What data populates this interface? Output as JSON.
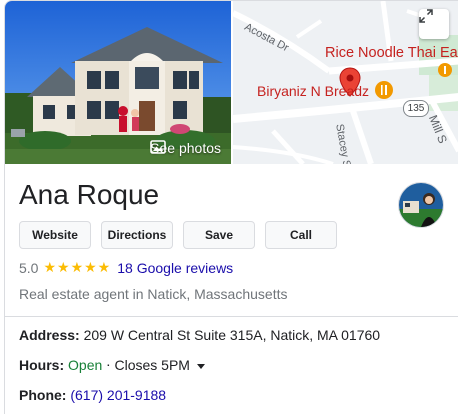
{
  "media": {
    "see_photos_label": "See photos",
    "map": {
      "places": {
        "rice_noodle": "Rice Noodle Thai Eate",
        "biryaniz": "Biryaniz N Breadz"
      },
      "streets": {
        "acosta": "Acosta Dr",
        "stacey": "Stacey St",
        "mill": "Mill S"
      },
      "route_shield": "135"
    }
  },
  "business": {
    "name": "Ana Roque",
    "rating": "5.0",
    "stars": "★★★★★",
    "reviews_label": "18 Google reviews",
    "category": "Real estate agent in Natick, Massachusetts"
  },
  "actions": {
    "website": "Website",
    "directions": "Directions",
    "save": "Save",
    "call": "Call"
  },
  "info": {
    "address_label": "Address:",
    "address_value": "209 W Central St Suite 315A, Natick, MA 01760",
    "hours_label": "Hours:",
    "hours_status": "Open",
    "hours_separator": "⋅",
    "hours_detail": "Closes 5PM",
    "phone_label": "Phone:",
    "phone_value": "(617) 201-9188"
  },
  "colors": {
    "link": "#1a0dab",
    "open_green": "#188038",
    "star": "#fbbc04",
    "place_red": "#c5221f"
  }
}
